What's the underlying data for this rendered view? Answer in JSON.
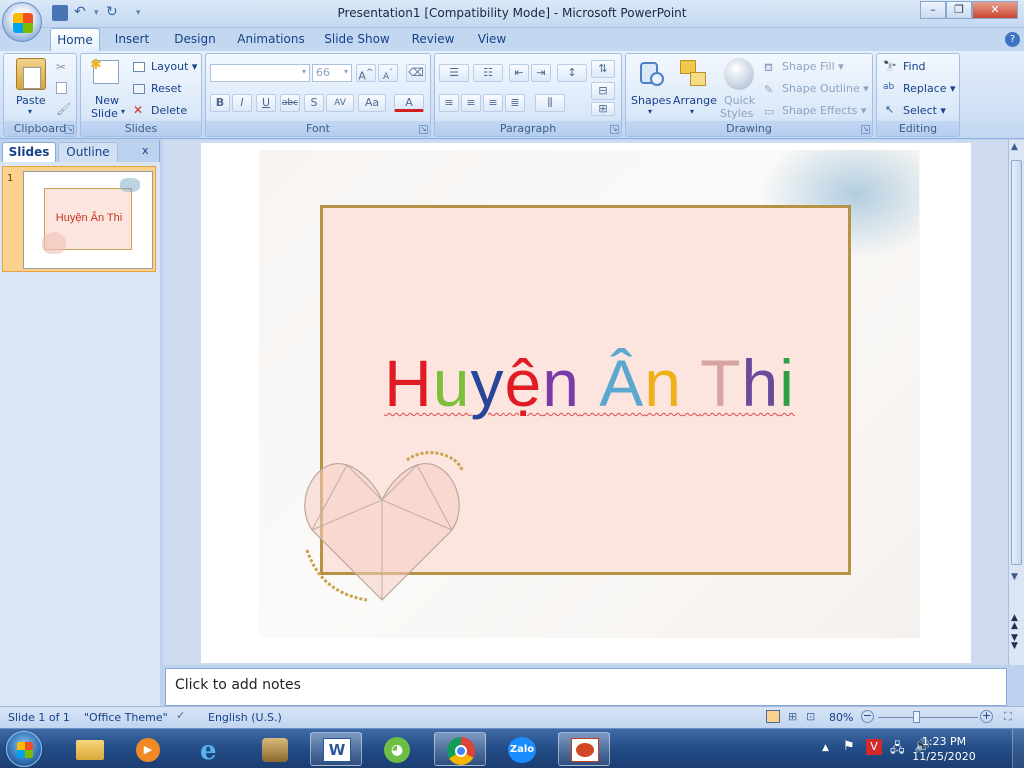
{
  "window": {
    "title": "Presentation1 [Compatibility Mode] - Microsoft PowerPoint",
    "minimize": "–",
    "restore": "❐",
    "close": "✕"
  },
  "tabs": [
    "Home",
    "Insert",
    "Design",
    "Animations",
    "Slide Show",
    "Review",
    "View"
  ],
  "ribbon": {
    "clipboard": {
      "label": "Clipboard",
      "paste": "Paste"
    },
    "slides": {
      "label": "Slides",
      "new_slide_line1": "New",
      "new_slide_line2": "Slide",
      "layout": "Layout",
      "reset": "Reset",
      "delete": "Delete"
    },
    "font": {
      "label": "Font",
      "font_name": "",
      "font_size": "66",
      "bold": "B",
      "italic": "I",
      "underline": "U",
      "strike": "abc",
      "shadow": "S",
      "spacing": "AV",
      "case": "Aa",
      "color": "A",
      "grow": "A",
      "shrink": "A"
    },
    "paragraph": {
      "label": "Paragraph"
    },
    "drawing": {
      "label": "Drawing",
      "shapes": "Shapes",
      "arrange": "Arrange",
      "quick_styles_line1": "Quick",
      "quick_styles_line2": "Styles",
      "shape_fill": "Shape Fill",
      "shape_outline": "Shape Outline",
      "shape_effects": "Shape Effects"
    },
    "editing": {
      "label": "Editing",
      "find": "Find",
      "replace": "Replace",
      "select": "Select"
    }
  },
  "pane": {
    "tab_slides": "Slides",
    "tab_outline": "Outline",
    "close": "x",
    "slide_number": "1",
    "thumb_text": "Huyện Ân Thi"
  },
  "slide": {
    "title_parts": [
      {
        "text": "H",
        "color": "#e01b24"
      },
      {
        "text": "u",
        "color": "#7cbf3a"
      },
      {
        "text": "y",
        "color": "#27459a"
      },
      {
        "text": "ệ",
        "color": "#e01b24"
      },
      {
        "text": "n",
        "color": "#7a3aa8"
      },
      {
        "text": " ",
        "color": "#000000"
      },
      {
        "text": "Â",
        "color": "#5aa7d0"
      },
      {
        "text": "n",
        "color": "#f0b019"
      },
      {
        "text": " ",
        "color": "#000000"
      },
      {
        "text": "T",
        "color": "#d9a3a3"
      },
      {
        "text": "h",
        "color": "#6a4b9a"
      },
      {
        "text": "i",
        "color": "#2ea043"
      }
    ]
  },
  "notes": {
    "placeholder": "Click to add notes"
  },
  "status": {
    "slide": "Slide 1 of 1",
    "theme": "\"Office Theme\"",
    "language": "English (U.S.)",
    "zoom": "80%",
    "zoom_level": 0.8
  },
  "clock": {
    "time": "1:23 PM",
    "date": "11/25/2020"
  },
  "taskbar": {
    "zalo": "Zalo"
  }
}
